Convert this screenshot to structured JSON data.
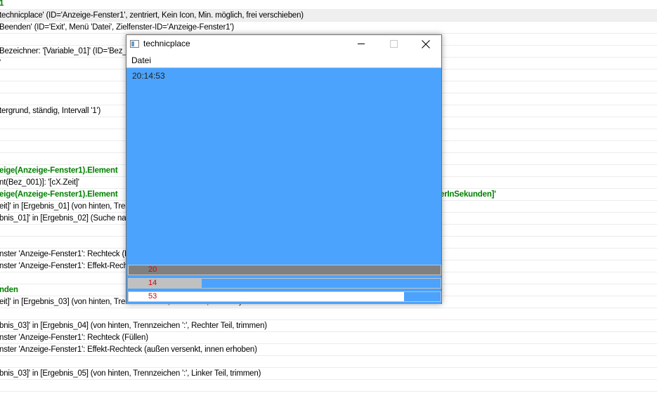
{
  "code_lines": [
    {
      "text": "1",
      "style": "green"
    },
    {
      "text": "technicplace' (ID='Anzeige-Fenster1', zentriert, Kein Icon, Min. möglich, frei verschieben)",
      "style": "sel"
    },
    {
      "text": "Beenden' (ID='Exit', Menü 'Datei', Zielfenster-ID='Anzeige-Fenster1')",
      "style": ""
    },
    {
      "text": "",
      "style": ""
    },
    {
      "text": "  Bezeichner: '[Variable_01]' (ID='Bez_",
      "style": ""
    },
    {
      "text": "'",
      "style": ""
    },
    {
      "text": "",
      "style": ""
    },
    {
      "text": "",
      "style": ""
    },
    {
      "text": "",
      "style": ""
    },
    {
      "text": "tergrund, ständig, Intervall '1')",
      "style": ""
    },
    {
      "text": "",
      "style": ""
    },
    {
      "text": "",
      "style": ""
    },
    {
      "text": "",
      "style": ""
    },
    {
      "text": "",
      "style": ""
    },
    {
      "text": "eige(Anzeige-Fenster1).Element",
      "style": "green"
    },
    {
      "text": "nt(Bez_001)]:  '[cX.Zeit]'",
      "style": ""
    },
    {
      "text": "eige(Anzeige-Fenster1).Element",
      "style": "green",
      "right": "erInSekunden]'"
    },
    {
      "text": "eit]' in [Ergebnis_01] (von hinten, Trenn",
      "style": ""
    },
    {
      "text": "bnis_01]' in [Ergebnis_02] (Suche nac",
      "style": ""
    },
    {
      "text": "",
      "style": ""
    },
    {
      "text": "",
      "style": ""
    },
    {
      "text": "nster 'Anzeige-Fenster1': Rechteck (Er",
      "style": ""
    },
    {
      "text": "nster 'Anzeige-Fenster1': Effekt-Rechte",
      "style": ""
    },
    {
      "text": "",
      "style": ""
    },
    {
      "text": "nden",
      "style": "green"
    },
    {
      "text": "eit]' in [Ergebnis_03] (von hinten, Trennzeichen ':', Linker Teil, trimmen)",
      "style": ""
    },
    {
      "text": "",
      "style": ""
    },
    {
      "text": "bnis_03]' in [Ergebnis_04] (von hinten, Trennzeichen ':', Rechter Teil, trimmen)",
      "style": ""
    },
    {
      "text": "nster 'Anzeige-Fenster1': Rechteck (Füllen)",
      "style": ""
    },
    {
      "text": "nster 'Anzeige-Fenster1': Effekt-Rechteck (außen versenkt, innen erhoben)",
      "style": ""
    },
    {
      "text": "",
      "style": ""
    },
    {
      "text": "bnis_03]' in [Ergebnis_05] (von hinten, Trennzeichen ':', Linker Teil, trimmen)",
      "style": ""
    },
    {
      "text": "",
      "style": ""
    }
  ],
  "window": {
    "title": "technicplace",
    "icon": "app-window-icon",
    "menu": {
      "datei": "Datei"
    },
    "clock": "20:14:53",
    "colors": {
      "client": "#4ba3fd",
      "hours_bar": "#808080",
      "minutes_fill": "#c0c0c0",
      "number": "#e00000"
    },
    "bars": {
      "hours": {
        "label": "20",
        "fraction": 1.0
      },
      "minutes": {
        "label": "14",
        "fraction": 0.2333
      },
      "seconds": {
        "label": "53",
        "fraction": 0.1167
      }
    }
  }
}
